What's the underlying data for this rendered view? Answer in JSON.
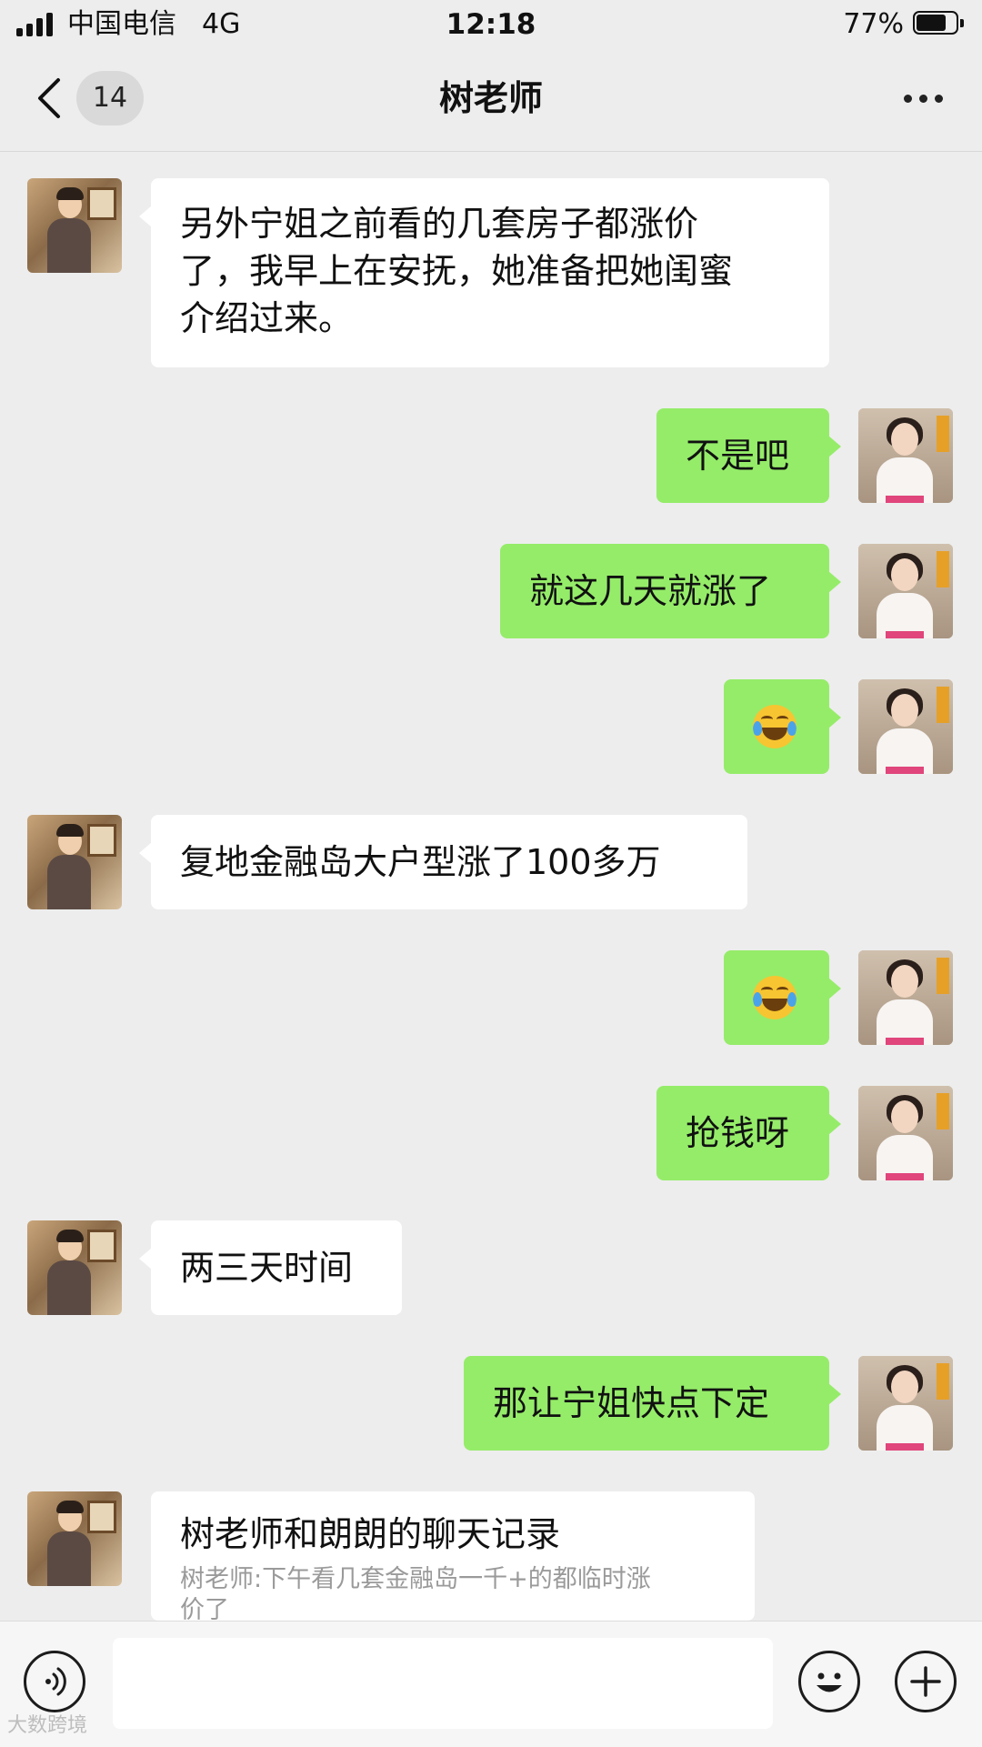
{
  "status_bar": {
    "carrier": "中国电信",
    "network": "4G",
    "time": "12:18",
    "battery_percent": "77%",
    "battery_level": 0.77
  },
  "nav": {
    "unread_count": "14",
    "title": "树老师"
  },
  "messages": [
    {
      "side": "left",
      "sender": "teacher",
      "text": "另外宁姐之前看的几套房子都涨价\n了，我早上在安抚，她准备把她闺蜜\n介绍过来。"
    },
    {
      "side": "right",
      "sender": "agent",
      "text": "不是吧"
    },
    {
      "side": "right",
      "sender": "agent",
      "text": "就这几天就涨了"
    },
    {
      "side": "right",
      "sender": "agent",
      "emoji": "tears-of-joy-emoji"
    },
    {
      "side": "left",
      "sender": "teacher",
      "text": "复地金融岛大户型涨了100多万"
    },
    {
      "side": "right",
      "sender": "agent",
      "emoji": "tears-of-joy-emoji"
    },
    {
      "side": "right",
      "sender": "agent",
      "text": "抢钱呀"
    },
    {
      "side": "left",
      "sender": "teacher",
      "text": "两三天时间"
    },
    {
      "side": "right",
      "sender": "agent",
      "text": "那让宁姐快点下定"
    }
  ],
  "chat_record": {
    "title": "树老师和朗朗的聊天记录",
    "preview": "树老师:下午看几套金融岛一千+的都临时涨\n价了"
  },
  "input_bar": {
    "placeholder": ""
  },
  "watermark": "大数跨境",
  "colors": {
    "background": "#ededed",
    "my_bubble": "#95ec69",
    "their_bubble": "#ffffff"
  }
}
